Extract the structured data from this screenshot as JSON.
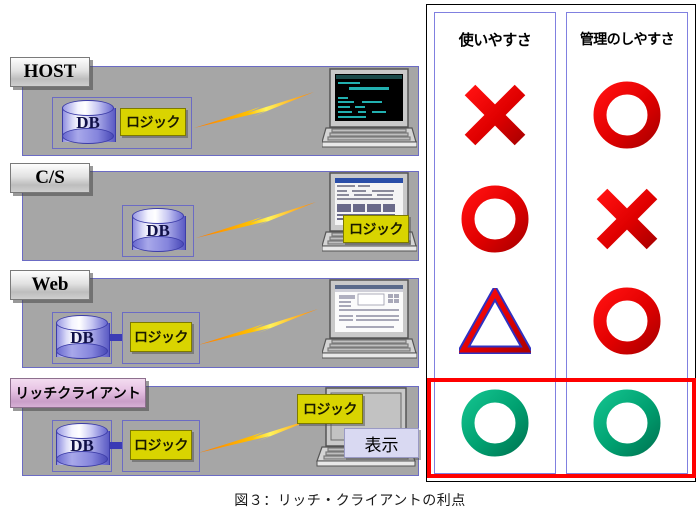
{
  "caption": "図３：リッチ・クライアントの利点",
  "diagram": {
    "rows": [
      {
        "title": "HOST",
        "db_label": "DB",
        "logic_label": "ロジック",
        "client_logic_label": "",
        "display_label": "",
        "screen_type": "terminal"
      },
      {
        "title": "C/S",
        "db_label": "DB",
        "logic_label": "",
        "client_logic_label": "ロジック",
        "display_label": "",
        "screen_type": "spreadsheet"
      },
      {
        "title": "Web",
        "db_label": "DB",
        "logic_label": "ロジック",
        "client_logic_label": "",
        "display_label": "",
        "screen_type": "browser"
      },
      {
        "title": "リッチクライアント",
        "db_label": "DB",
        "logic_label": "ロジック",
        "client_logic_label": "ロジック",
        "display_label": "表示",
        "screen_type": "blank"
      }
    ]
  },
  "table": {
    "columns": [
      {
        "header": "使いやすさ",
        "marks": [
          "cross",
          "circle",
          "triangle",
          "circle"
        ],
        "mark_colors": [
          "#e00000",
          "#e00000",
          "#e00000",
          "#00a070"
        ]
      },
      {
        "header": "管理のしやすさ",
        "marks": [
          "circle",
          "cross",
          "circle",
          "circle"
        ],
        "mark_colors": [
          "#e00000",
          "#e00000",
          "#e00000",
          "#00a070"
        ]
      }
    ],
    "highlight_row_index": 3,
    "highlight_color": "#ff0000"
  },
  "colors": {
    "panel_grey": "#a6a6a6",
    "panel_border_blue": "#6b6bc4",
    "logic_yellow": "#d9d400",
    "display_lavender": "#d9d9f2",
    "bolt_orange": "#ff8a00",
    "bolt_yellow": "#ffe400",
    "mark_red": "#e00000",
    "mark_green": "#00a070",
    "rich_client_pink": "#d7b0d5"
  }
}
